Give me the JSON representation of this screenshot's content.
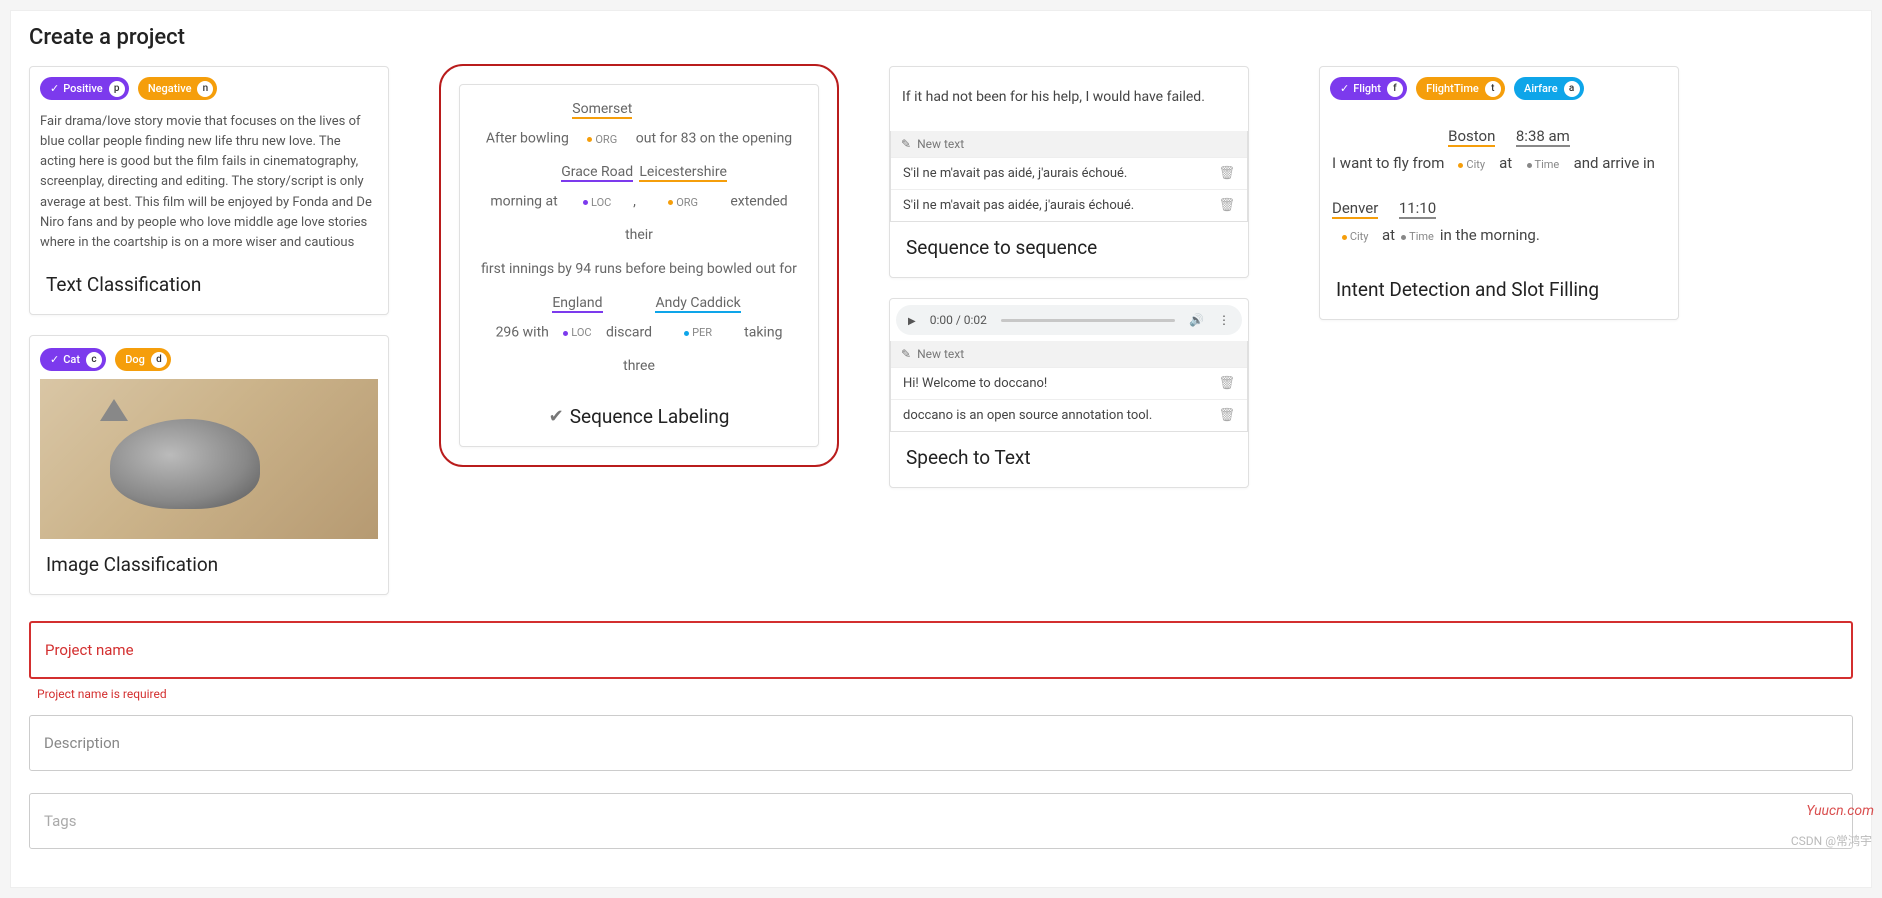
{
  "page": {
    "title": "Create a project"
  },
  "cards": {
    "text_classification": {
      "title": "Text Classification",
      "chips": [
        {
          "label": "Positive",
          "key": "p",
          "color": "purple",
          "checked": true
        },
        {
          "label": "Negative",
          "key": "n",
          "color": "orange"
        }
      ],
      "sample": "Fair drama/love story movie that focuses on the lives of blue collar people finding new life thru new love. The acting here is good but the film fails in cinematography, screenplay, directing and editing. The story/script is only average at best. This film will be enjoyed by Fonda and De Niro fans and by people who love middle age love stories where in the coartship is on a more wiser and cautious"
    },
    "image_classification": {
      "title": "Image Classification",
      "chips": [
        {
          "label": "Cat",
          "key": "c",
          "color": "purple",
          "checked": true
        },
        {
          "label": "Dog",
          "key": "d",
          "color": "orange"
        }
      ]
    },
    "sequence_labeling": {
      "title": "Sequence Labeling",
      "selected": true,
      "tokens": {
        "l1a": "After bowling ",
        "t1": "Somerset",
        "lab1": "ORG",
        "l1b": " out for 83 on the opening",
        "l2a": "morning at ",
        "t2": "Grace Road",
        "lab2": "LOC",
        "l2b": ", ",
        "t3": "Leicestershire",
        "lab3": "ORG",
        "l2c": " extended their",
        "l3": "first innings by 94 runs before being bowled out for",
        "l4a": "296 with ",
        "t4": "England",
        "lab4": "LOC",
        "l4b": " discard ",
        "t5": "Andy Caddick",
        "lab5": "PER",
        "l4c": " taking three"
      }
    },
    "sequence_to_sequence": {
      "title": "Sequence to sequence",
      "source": "If it had not been for his help, I would have failed.",
      "new_text": "New text",
      "rows": [
        "S'il ne m'avait pas aidé, j'aurais échoué.",
        "S'il ne m'avait pas aidée, j'aurais échoué."
      ]
    },
    "speech_to_text": {
      "title": "Speech to Text",
      "time": "0:00 / 0:02",
      "new_text": "New text",
      "rows": [
        "Hi! Welcome to doccano!",
        "doccano is an open source annotation tool."
      ]
    },
    "intent_slot": {
      "title": "Intent Detection and Slot Filling",
      "chips": [
        {
          "label": "Flight",
          "key": "f",
          "color": "purple",
          "checked": true
        },
        {
          "label": "FlightTime",
          "key": "t",
          "color": "orange"
        },
        {
          "label": "Airfare",
          "key": "a",
          "color": "blue"
        }
      ],
      "tokens": {
        "a1": "I want to fly from ",
        "t1": "Boston",
        "a2": " at ",
        "t2": "8:38 am",
        "a3": " and arrive in",
        "lab_city": "City",
        "lab_time": "Time",
        "b1": "Denver",
        "b2": " at ",
        "b3": "11:10",
        "b4": " in the morning."
      }
    }
  },
  "form": {
    "project_name": {
      "placeholder": "Project name",
      "error": "Project name is required"
    },
    "description": {
      "placeholder": "Description"
    },
    "tags": {
      "placeholder": "Tags"
    }
  },
  "watermark": "Yuucn.com",
  "csdn": "CSDN @常鸿宇"
}
